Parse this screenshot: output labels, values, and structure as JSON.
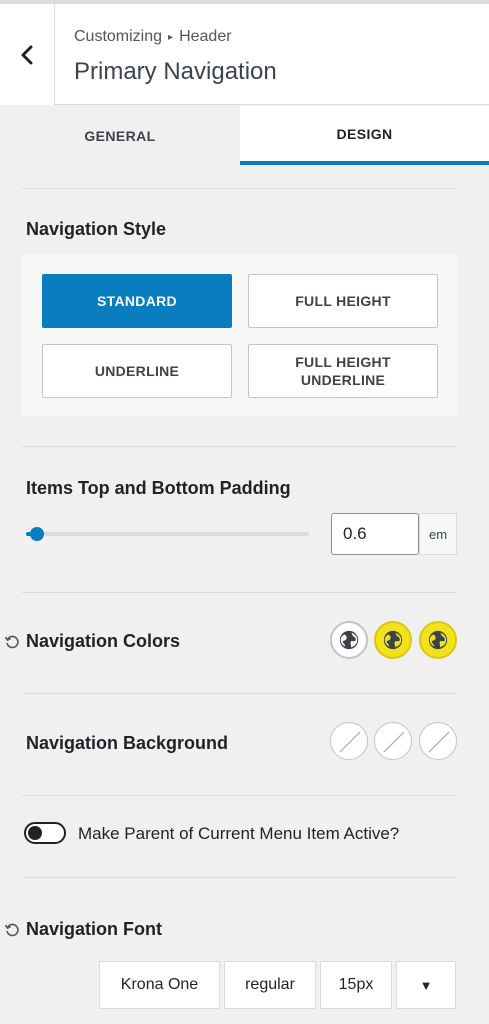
{
  "header": {
    "back_label": "‹",
    "breadcrumb_parent": "Customizing",
    "breadcrumb_sep": "▸",
    "breadcrumb_section": "Header",
    "title": "Primary Navigation"
  },
  "tabs": [
    {
      "label": "GENERAL",
      "active": false
    },
    {
      "label": "DESIGN",
      "active": true
    }
  ],
  "nav_style": {
    "title": "Navigation Style",
    "options": [
      {
        "label": "STANDARD",
        "active": true
      },
      {
        "label": "FULL HEIGHT",
        "active": false
      },
      {
        "label": "UNDERLINE",
        "active": false
      },
      {
        "label": "FULL HEIGHT UNDERLINE",
        "active": false
      }
    ]
  },
  "padding": {
    "title": "Items Top and Bottom Padding",
    "value": "0.6",
    "unit": "em",
    "slider_fraction": 0.04
  },
  "nav_colors": {
    "title": "Navigation Colors",
    "swatches": [
      {
        "icon": "globe-icon",
        "color": "#ffffff"
      },
      {
        "icon": "globe-icon",
        "color": "#f2e21c"
      },
      {
        "icon": "globe-icon",
        "color": "#f2e21c"
      }
    ]
  },
  "nav_background": {
    "title": "Navigation Background",
    "swatches": [
      {
        "icon": "no-color-icon"
      },
      {
        "icon": "no-color-icon"
      },
      {
        "icon": "no-color-icon"
      }
    ]
  },
  "parent_active": {
    "label": "Make Parent of Current Menu Item Active?",
    "checked": false
  },
  "nav_font": {
    "title": "Navigation Font",
    "family": "Krona One",
    "weight": "regular",
    "size": "15px",
    "more": "▼"
  },
  "colors": {
    "accent": "#0a7cc0",
    "yellow": "#f2e21c"
  }
}
